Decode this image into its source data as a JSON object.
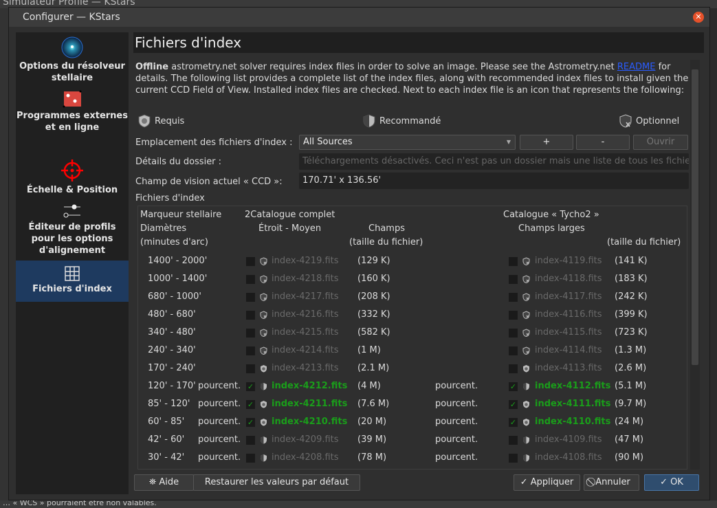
{
  "background": {
    "title": "Simulateur Profile — KStars",
    "status": "… « WCS » pourraient être non valables."
  },
  "window": {
    "title": "Configurer — KStars",
    "close_icon": "close-icon"
  },
  "sidebar": {
    "items": [
      {
        "label": "Options du résolveur stellaire",
        "icon": "star-field-icon"
      },
      {
        "label": "Programmes externes et en ligne",
        "icon": "dice-icon"
      },
      {
        "label": "Échelle & Position",
        "icon": "crosshair-icon"
      },
      {
        "label": "Éditeur de profils pour les options d'alignement",
        "icon": "sliders-icon"
      },
      {
        "label": "Fichiers d'index",
        "icon": "grid-icon",
        "selected": true
      }
    ]
  },
  "page": {
    "title": "Fichiers d'index",
    "desc_bold": "Offline",
    "desc_1": " astrometry.net solver requires index files in order to solve an image. Please see the Astrometry.net ",
    "desc_link": "README",
    "desc_2": " for details. The following list provides a complete list of the index files, along with recommended index files to install given the current CCD Field of View. Installed index files are checked. Next to each index file is an icon that represents the following:",
    "legend": {
      "required": "Requis",
      "recommended": "Recommandé",
      "optional": "Optionnel"
    },
    "location_label": "Emplacement des fichiers d'index :",
    "location_value": "All Sources",
    "add": "+",
    "remove": "-",
    "open": "Ouvrir",
    "details_label": "Détails du dossier :",
    "details_value": "Téléchargements désactivés. Ceci n'est pas un dossier mais une liste de tous les fichiers",
    "fov_label": "Champ de vision actuel « CCD »:",
    "fov_value": "170.71' x 136.56'",
    "files_label": "Fichiers d'index"
  },
  "table": {
    "headers": {
      "marker": "Marqueur stellaire",
      "diam": "Diamètres",
      "unit": "(minutes d'arc)",
      "cat2": "2Catalogue complet",
      "narrow": "Étroit - Moyen",
      "fields": "Champs",
      "size1": "(taille du fichier)",
      "tycho": "Catalogue « Tycho2 »",
      "wide": "Champs larges",
      "size2": "(taille du fichier)"
    },
    "rows": [
      {
        "range": "1400' - 2000'",
        "pct": "",
        "c1": false,
        "f1": "index-4219.fits",
        "s1": "(129 K)",
        "pct2": "",
        "c2": false,
        "f2": "index-4119.fits",
        "s2": "(141 K)",
        "icon": "optional"
      },
      {
        "range": "1000' - 1400'",
        "pct": "",
        "c1": false,
        "f1": "index-4218.fits",
        "s1": "(160 K)",
        "pct2": "",
        "c2": false,
        "f2": "index-4118.fits",
        "s2": "(183 K)",
        "icon": "optional"
      },
      {
        "range": "680' - 1000'",
        "pct": "",
        "c1": false,
        "f1": "index-4217.fits",
        "s1": "(208 K)",
        "pct2": "",
        "c2": false,
        "f2": "index-4117.fits",
        "s2": "(242 K)",
        "icon": "optional"
      },
      {
        "range": "480' - 680'",
        "pct": "",
        "c1": false,
        "f1": "index-4216.fits",
        "s1": "(332 K)",
        "pct2": "",
        "c2": false,
        "f2": "index-4116.fits",
        "s2": "(399 K)",
        "icon": "optional"
      },
      {
        "range": "340' - 480'",
        "pct": "",
        "c1": false,
        "f1": "index-4215.fits",
        "s1": "(582 K)",
        "pct2": "",
        "c2": false,
        "f2": "index-4115.fits",
        "s2": "(723 K)",
        "icon": "optional"
      },
      {
        "range": "240' - 340'",
        "pct": "",
        "c1": false,
        "f1": "index-4214.fits",
        "s1": "(1 M)",
        "pct2": "",
        "c2": false,
        "f2": "index-4114.fits",
        "s2": "(1.3 M)",
        "icon": "optional"
      },
      {
        "range": "170' - 240'",
        "pct": "",
        "c1": false,
        "f1": "index-4213.fits",
        "s1": "(2.1 M)",
        "pct2": "",
        "c2": false,
        "f2": "index-4113.fits",
        "s2": "(2.6 M)",
        "icon": "required"
      },
      {
        "range": "120' - 170'",
        "pct": "pourcent.",
        "c1": true,
        "f1": "index-4212.fits",
        "s1": "(4 M)",
        "pct2": "pourcent.",
        "c2": true,
        "f2": "index-4112.fits",
        "s2": "(5.1 M)",
        "icon": "recommended"
      },
      {
        "range": "85' - 120'",
        "pct": "pourcent.",
        "c1": true,
        "f1": "index-4211.fits",
        "s1": "(7.6 M)",
        "pct2": "pourcent.",
        "c2": true,
        "f2": "index-4111.fits",
        "s2": "(9.7 M)",
        "icon": "required"
      },
      {
        "range": "60' - 85'",
        "pct": "pourcent.",
        "c1": true,
        "f1": "index-4210.fits",
        "s1": "(20 M)",
        "pct2": "pourcent.",
        "c2": true,
        "f2": "index-4110.fits",
        "s2": "(24 M)",
        "icon": "required"
      },
      {
        "range": "42' - 60'",
        "pct": "pourcent.",
        "c1": false,
        "f1": "index-4209.fits",
        "s1": "(39 M)",
        "pct2": "pourcent.",
        "c2": false,
        "f2": "index-4109.fits",
        "s2": "(47 M)",
        "icon": "recommended"
      },
      {
        "range": "30' - 42'",
        "pct": "pourcent.",
        "c1": false,
        "f1": "index-4208.fits",
        "s1": "(78 M)",
        "pct2": "pourcent.",
        "c2": false,
        "f2": "index-4108.fits",
        "s2": "(90 M)",
        "icon": "recommended"
      }
    ]
  },
  "buttons": {
    "help": "Aide",
    "defaults": "Restaurer les valeurs par défaut",
    "apply": "✓ Appliquer",
    "cancel": "⃠ Annuler",
    "ok": "✓ OK"
  }
}
